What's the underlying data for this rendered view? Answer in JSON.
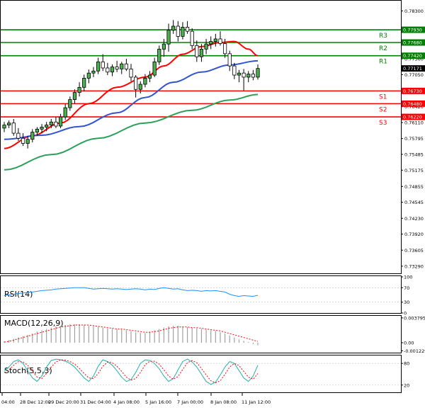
{
  "chart_data": {
    "type": "candlestick",
    "instrument_timeframe": "",
    "price_axis": {
      "ylim": [
        0.7315,
        0.785
      ],
      "ticks": [
        "0.78300",
        "0.77930",
        "0.77680",
        "0.77420",
        "0.77360",
        "0.77050",
        "0.76730",
        "0.76420",
        "0.76110",
        "0.75795",
        "0.75485",
        "0.75175",
        "0.74855",
        "0.74545",
        "0.74230",
        "0.73920",
        "0.73605",
        "0.73290"
      ],
      "tick_values": [
        0.783,
        0.7793,
        0.7768,
        0.7742,
        0.7736,
        0.7705,
        0.7673,
        0.7642,
        0.7611,
        0.75795,
        0.75485,
        0.75175,
        0.74855,
        0.74545,
        0.7423,
        0.7392,
        0.73605,
        0.7329
      ],
      "last_price": "0.77171",
      "last_price_value": 0.77171
    },
    "levels": [
      {
        "name": "R3",
        "value": 0.7793,
        "label": "0.77930",
        "color": "#008000"
      },
      {
        "name": "R2",
        "value": 0.7768,
        "label": "0.77680",
        "color": "#008000"
      },
      {
        "name": "R1",
        "value": 0.7742,
        "label": "0.77420",
        "color": "#008000"
      },
      {
        "name": "S1",
        "value": 0.7673,
        "label": "0.76730",
        "color": "#ff0000"
      },
      {
        "name": "S2",
        "value": 0.7648,
        "label": "0.76480",
        "color": "#ff0000"
      },
      {
        "name": "S3",
        "value": 0.7622,
        "label": "0.76220",
        "color": "#ff0000"
      }
    ],
    "x_labels": [
      "04:00",
      "28 Dec 12:00",
      "29 Dec 20:00",
      "31 Dec 04:00",
      "4 Jan 08:00",
      "5 Jan 16:00",
      "7 Jan 00:00",
      "8 Jan 08:00",
      "11 Jan 12:00"
    ],
    "candles": [
      {
        "o": 0.76,
        "h": 0.7612,
        "l": 0.7592,
        "c": 0.7606
      },
      {
        "o": 0.7606,
        "h": 0.7615,
        "l": 0.76,
        "c": 0.761
      },
      {
        "o": 0.761,
        "h": 0.7618,
        "l": 0.7585,
        "c": 0.759
      },
      {
        "o": 0.759,
        "h": 0.76,
        "l": 0.7575,
        "c": 0.758
      },
      {
        "o": 0.758,
        "h": 0.759,
        "l": 0.7565,
        "c": 0.757
      },
      {
        "o": 0.757,
        "h": 0.7585,
        "l": 0.756,
        "c": 0.7578
      },
      {
        "o": 0.7578,
        "h": 0.7598,
        "l": 0.7572,
        "c": 0.7592
      },
      {
        "o": 0.7592,
        "h": 0.7602,
        "l": 0.7585,
        "c": 0.7598
      },
      {
        "o": 0.7598,
        "h": 0.7608,
        "l": 0.759,
        "c": 0.7602
      },
      {
        "o": 0.7602,
        "h": 0.7612,
        "l": 0.7594,
        "c": 0.7606
      },
      {
        "o": 0.7606,
        "h": 0.7618,
        "l": 0.76,
        "c": 0.7612
      },
      {
        "o": 0.7612,
        "h": 0.7622,
        "l": 0.76,
        "c": 0.7604
      },
      {
        "o": 0.7604,
        "h": 0.7628,
        "l": 0.76,
        "c": 0.7622
      },
      {
        "o": 0.7622,
        "h": 0.7648,
        "l": 0.7616,
        "c": 0.764
      },
      {
        "o": 0.764,
        "h": 0.7662,
        "l": 0.7634,
        "c": 0.7656
      },
      {
        "o": 0.7656,
        "h": 0.7676,
        "l": 0.7648,
        "c": 0.767
      },
      {
        "o": 0.767,
        "h": 0.769,
        "l": 0.7662,
        "c": 0.768
      },
      {
        "o": 0.768,
        "h": 0.7705,
        "l": 0.7672,
        "c": 0.7698
      },
      {
        "o": 0.7698,
        "h": 0.7715,
        "l": 0.7688,
        "c": 0.7708
      },
      {
        "o": 0.7708,
        "h": 0.772,
        "l": 0.77,
        "c": 0.7712
      },
      {
        "o": 0.7712,
        "h": 0.7738,
        "l": 0.7706,
        "c": 0.773
      },
      {
        "o": 0.773,
        "h": 0.7745,
        "l": 0.7712,
        "c": 0.7718
      },
      {
        "o": 0.7718,
        "h": 0.7728,
        "l": 0.7704,
        "c": 0.771
      },
      {
        "o": 0.771,
        "h": 0.7725,
        "l": 0.7702,
        "c": 0.772
      },
      {
        "o": 0.772,
        "h": 0.7732,
        "l": 0.771,
        "c": 0.7716
      },
      {
        "o": 0.7716,
        "h": 0.773,
        "l": 0.7706,
        "c": 0.7726
      },
      {
        "o": 0.7726,
        "h": 0.7736,
        "l": 0.7712,
        "c": 0.7716
      },
      {
        "o": 0.7716,
        "h": 0.7726,
        "l": 0.7692,
        "c": 0.77
      },
      {
        "o": 0.77,
        "h": 0.7704,
        "l": 0.766,
        "c": 0.7676
      },
      {
        "o": 0.7676,
        "h": 0.7692,
        "l": 0.7668,
        "c": 0.7686
      },
      {
        "o": 0.7686,
        "h": 0.7706,
        "l": 0.768,
        "c": 0.7698
      },
      {
        "o": 0.7698,
        "h": 0.7712,
        "l": 0.769,
        "c": 0.7704
      },
      {
        "o": 0.7704,
        "h": 0.7738,
        "l": 0.77,
        "c": 0.773
      },
      {
        "o": 0.773,
        "h": 0.7762,
        "l": 0.7724,
        "c": 0.7755
      },
      {
        "o": 0.7755,
        "h": 0.7775,
        "l": 0.774,
        "c": 0.7765
      },
      {
        "o": 0.7765,
        "h": 0.7805,
        "l": 0.775,
        "c": 0.7792
      },
      {
        "o": 0.7792,
        "h": 0.7812,
        "l": 0.7785,
        "c": 0.78
      },
      {
        "o": 0.78,
        "h": 0.781,
        "l": 0.777,
        "c": 0.778
      },
      {
        "o": 0.778,
        "h": 0.7808,
        "l": 0.7774,
        "c": 0.7798
      },
      {
        "o": 0.7798,
        "h": 0.781,
        "l": 0.7785,
        "c": 0.779
      },
      {
        "o": 0.779,
        "h": 0.7796,
        "l": 0.7755,
        "c": 0.7762
      },
      {
        "o": 0.7762,
        "h": 0.7772,
        "l": 0.773,
        "c": 0.774
      },
      {
        "o": 0.774,
        "h": 0.7765,
        "l": 0.773,
        "c": 0.7755
      },
      {
        "o": 0.7755,
        "h": 0.7775,
        "l": 0.7745,
        "c": 0.7765
      },
      {
        "o": 0.7765,
        "h": 0.778,
        "l": 0.7755,
        "c": 0.777
      },
      {
        "o": 0.777,
        "h": 0.7785,
        "l": 0.776,
        "c": 0.7775
      },
      {
        "o": 0.7775,
        "h": 0.779,
        "l": 0.7762,
        "c": 0.7766
      },
      {
        "o": 0.7766,
        "h": 0.7775,
        "l": 0.7738,
        "c": 0.7746
      },
      {
        "o": 0.7746,
        "h": 0.7752,
        "l": 0.7712,
        "c": 0.7722
      },
      {
        "o": 0.7722,
        "h": 0.7728,
        "l": 0.7696,
        "c": 0.7704
      },
      {
        "o": 0.7704,
        "h": 0.7714,
        "l": 0.769,
        "c": 0.7708
      },
      {
        "o": 0.7708,
        "h": 0.7716,
        "l": 0.7674,
        "c": 0.77
      },
      {
        "o": 0.77,
        "h": 0.7712,
        "l": 0.769,
        "c": 0.7706
      },
      {
        "o": 0.7706,
        "h": 0.7714,
        "l": 0.7694,
        "c": 0.77
      },
      {
        "o": 0.77,
        "h": 0.7725,
        "l": 0.7695,
        "c": 0.7717
      }
    ],
    "moving_averages": [
      {
        "color": "#ff0000",
        "points": [
          [
            0,
            0.756
          ],
          [
            6,
            0.7585
          ],
          [
            12,
            0.761
          ],
          [
            18,
            0.7648
          ],
          [
            24,
            0.768
          ],
          [
            30,
            0.77
          ],
          [
            34,
            0.7722
          ],
          [
            38,
            0.7745
          ],
          [
            42,
            0.776
          ],
          [
            46,
            0.7768
          ],
          [
            49,
            0.777
          ],
          [
            52,
            0.7755
          ],
          [
            54,
            0.7742
          ]
        ]
      },
      {
        "color": "#3355cc",
        "points": [
          [
            0,
            0.7578
          ],
          [
            8,
            0.7586
          ],
          [
            16,
            0.7603
          ],
          [
            24,
            0.763
          ],
          [
            30,
            0.766
          ],
          [
            36,
            0.769
          ],
          [
            42,
            0.771
          ],
          [
            48,
            0.7724
          ],
          [
            54,
            0.7732
          ]
        ]
      },
      {
        "color": "#2ca05a",
        "points": [
          [
            0,
            0.7518
          ],
          [
            10,
            0.7548
          ],
          [
            20,
            0.758
          ],
          [
            30,
            0.761
          ],
          [
            40,
            0.7635
          ],
          [
            48,
            0.7655
          ],
          [
            54,
            0.7666
          ]
        ]
      }
    ],
    "rsi": {
      "label": "RSI(14)",
      "ticks": [
        "100",
        "70",
        "30",
        "0"
      ],
      "tick_values": [
        100,
        70,
        30,
        0
      ],
      "values": [
        48,
        50,
        52,
        54,
        55,
        57,
        58,
        60,
        62,
        63,
        64,
        66,
        67,
        68,
        69,
        70,
        70,
        70,
        68,
        66,
        67,
        68,
        67,
        66,
        67,
        66,
        65,
        66,
        67,
        66,
        64,
        66,
        65,
        68,
        70,
        68,
        66,
        67,
        64,
        62,
        63,
        62,
        60,
        62,
        61,
        62,
        60,
        58,
        52,
        48,
        46,
        48,
        47,
        46,
        49
      ]
    },
    "macd": {
      "label": "MACD(12,26,9)",
      "ticks": [
        "0.003795",
        "0.00",
        "-0.001229"
      ],
      "tick_values": [
        0.003795,
        0,
        -0.001229
      ],
      "histogram": [
        0.0002,
        0.0004,
        0.0006,
        0.0008,
        0.001,
        0.0012,
        0.0014,
        0.0017,
        0.0019,
        0.0021,
        0.0023,
        0.0025,
        0.0026,
        0.0027,
        0.0028,
        0.0028,
        0.0028,
        0.0027,
        0.0026,
        0.0025,
        0.0024,
        0.0023,
        0.0022,
        0.0021,
        0.0021,
        0.002,
        0.0019,
        0.0018,
        0.0016,
        0.0015,
        0.0015,
        0.0017,
        0.0019,
        0.0021,
        0.0023,
        0.0025,
        0.0026,
        0.0026,
        0.0025,
        0.0024,
        0.0023,
        0.0022,
        0.0021,
        0.002,
        0.0019,
        0.0018,
        0.0016,
        0.0014,
        0.0011,
        0.0008,
        0.0005,
        0.0003,
        0.0001,
        -0.0002,
        -0.0004
      ],
      "signal": [
        0.0001,
        0.0002,
        0.0004,
        0.0006,
        0.0008,
        0.001,
        0.0012,
        0.0014,
        0.0016,
        0.0018,
        0.002,
        0.0022,
        0.0024,
        0.0025,
        0.0026,
        0.0027,
        0.0027,
        0.0027,
        0.0027,
        0.0026,
        0.0025,
        0.0024,
        0.0023,
        0.0022,
        0.0021,
        0.0021,
        0.002,
        0.0019,
        0.0018,
        0.0017,
        0.0016,
        0.0016,
        0.0017,
        0.0018,
        0.002,
        0.0022,
        0.0023,
        0.0024,
        0.0024,
        0.0024,
        0.0023,
        0.0023,
        0.0022,
        0.0021,
        0.002,
        0.0019,
        0.0018,
        0.0016,
        0.0014,
        0.0012,
        0.001,
        0.0008,
        0.0006,
        0.0004,
        0.0002
      ]
    },
    "stoch": {
      "label": "Stoch(5,5,3)",
      "ticks": [
        "80",
        "20"
      ],
      "tick_values": [
        80,
        20
      ],
      "k": [
        60,
        70,
        85,
        90,
        80,
        60,
        40,
        30,
        45,
        70,
        88,
        92,
        90,
        86,
        80,
        70,
        55,
        40,
        30,
        45,
        72,
        90,
        85,
        75,
        60,
        42,
        30,
        35,
        55,
        80,
        90,
        88,
        80,
        65,
        45,
        30,
        38,
        62,
        85,
        92,
        84,
        70,
        50,
        30,
        22,
        28,
        48,
        70,
        85,
        80,
        60,
        40,
        30,
        45,
        75
      ],
      "d": [
        55,
        62,
        75,
        85,
        84,
        75,
        58,
        42,
        38,
        52,
        70,
        84,
        90,
        89,
        85,
        78,
        66,
        52,
        40,
        38,
        52,
        72,
        84,
        82,
        72,
        58,
        42,
        34,
        38,
        55,
        76,
        86,
        86,
        78,
        62,
        45,
        36,
        44,
        63,
        82,
        88,
        82,
        66,
        48,
        32,
        26,
        32,
        50,
        70,
        80,
        74,
        58,
        42,
        36,
        52
      ]
    }
  }
}
